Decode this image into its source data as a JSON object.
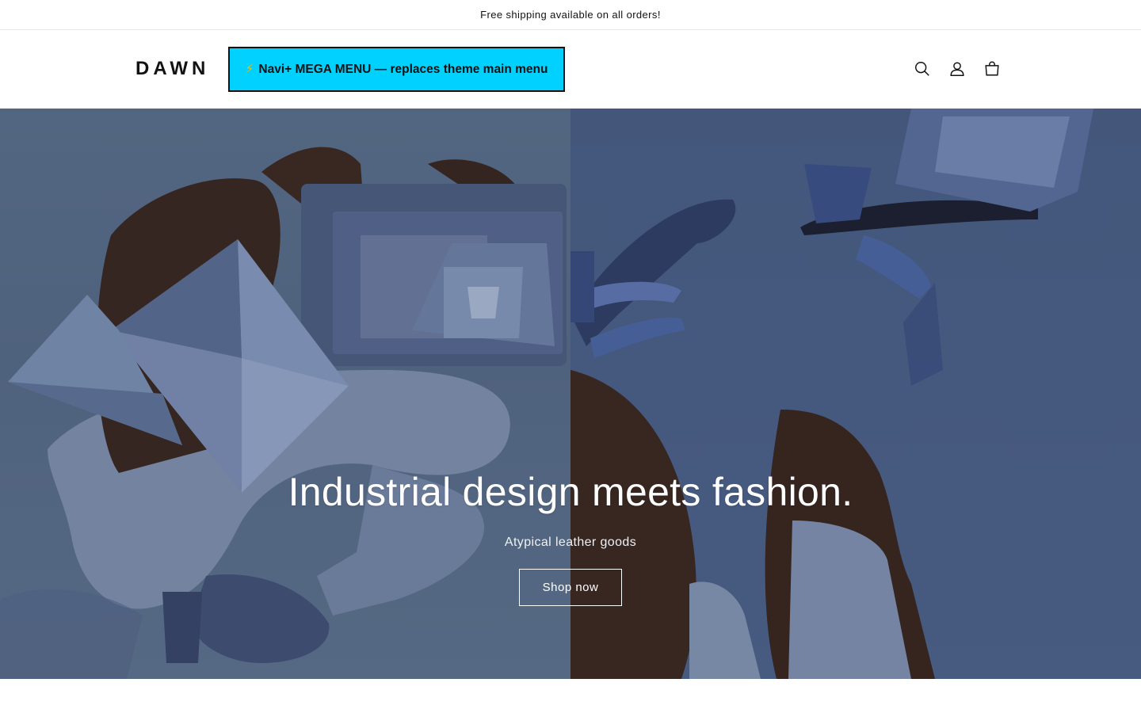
{
  "announcement": {
    "text": "Free shipping available on all orders!"
  },
  "header": {
    "logo": "DAWN",
    "mega_menu": {
      "icon": "lightning-bolt-icon",
      "label": "Navi+ MEGA MENU — replaces theme main menu",
      "background": "#00d1ff"
    },
    "icons": [
      {
        "name": "search-icon"
      },
      {
        "name": "account-icon"
      },
      {
        "name": "cart-icon"
      }
    ]
  },
  "hero": {
    "title": "Industrial design meets fashion.",
    "subtitle": "Atypical leather goods",
    "button_label": "Shop now",
    "left_image_color": "#5a6f8c",
    "right_image_color": "#4b6089"
  }
}
